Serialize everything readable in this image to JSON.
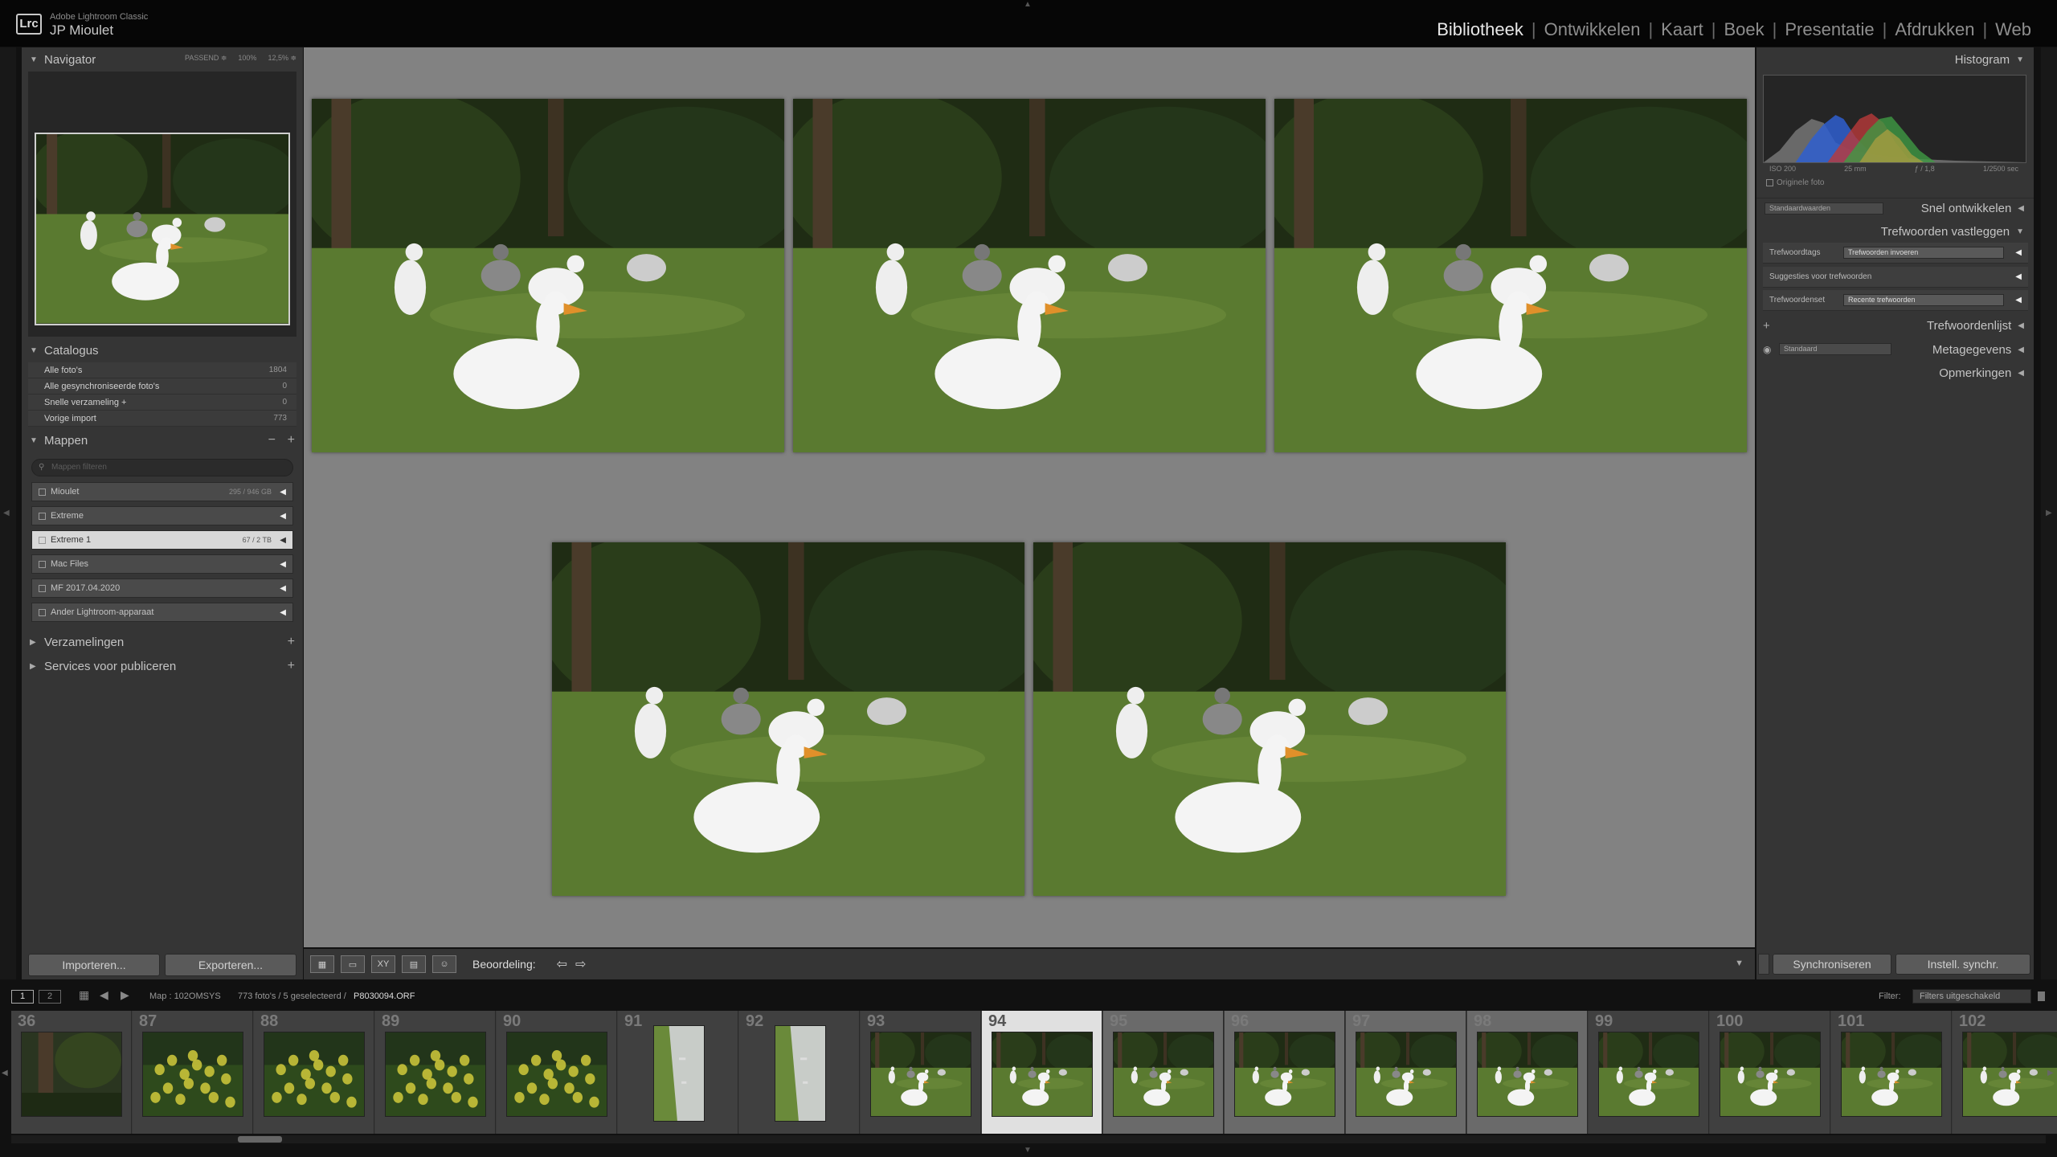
{
  "app": {
    "logo": "Lrc",
    "name": "Adobe Lightroom Classic",
    "user": "JP Mioulet"
  },
  "modules": [
    {
      "label": "Bibliotheek",
      "active": true
    },
    {
      "label": "Ontwikkelen",
      "active": false
    },
    {
      "label": "Kaart",
      "active": false
    },
    {
      "label": "Boek",
      "active": false
    },
    {
      "label": "Presentatie",
      "active": false
    },
    {
      "label": "Afdrukken",
      "active": false
    },
    {
      "label": "Web",
      "active": false
    }
  ],
  "left": {
    "navigator": {
      "title": "Navigator",
      "options": [
        "PASSEND ≑",
        "100%",
        "12,5% ≑"
      ]
    },
    "catalog": {
      "title": "Catalogus",
      "items": [
        {
          "label": "Alle foto's",
          "count": "1804"
        },
        {
          "label": "Alle gesynchroniseerde foto's",
          "count": "0"
        },
        {
          "label": "Snelle verzameling +",
          "count": "0"
        },
        {
          "label": "Vorige import",
          "count": "773"
        }
      ]
    },
    "folders": {
      "title": "Mappen",
      "search_placeholder": "Mappen filteren",
      "items": [
        {
          "label": "Mioulet",
          "size": "295 / 946 GB",
          "selected": false
        },
        {
          "label": "Extreme",
          "size": "",
          "selected": false
        },
        {
          "label": "Extreme 1",
          "size": "67 / 2 TB",
          "selected": true
        },
        {
          "label": "Mac Files",
          "size": "",
          "selected": false
        },
        {
          "label": "MF 2017.04.2020",
          "size": "",
          "selected": false
        },
        {
          "label": "Ander Lightroom-apparaat",
          "size": "",
          "selected": false
        }
      ]
    },
    "collections": {
      "title": "Verzamelingen"
    },
    "publish": {
      "title": "Services voor publiceren"
    },
    "import_label": "Importeren...",
    "export_label": "Exporteren..."
  },
  "toolbar": {
    "rating_label": "Beoordeling:"
  },
  "right": {
    "histogram": {
      "title": "Histogram",
      "iso": "ISO 200",
      "focal": "25 mm",
      "aperture": "ƒ / 1,8",
      "shutter": "1/2500 sec",
      "original_label": "Originele foto"
    },
    "quick_develop": {
      "title": "Snel ontwikkelen",
      "preset": "Standaardwaarden"
    },
    "keywording": {
      "title": "Trefwoorden vastleggen",
      "tags_label": "Trefwoordtags",
      "tags_placeholder": "Trefwoorden invoeren",
      "suggestions_label": "Suggesties voor trefwoorden",
      "set_label": "Trefwoordenset",
      "set_value": "Recente trefwoorden"
    },
    "keyword_list": {
      "title": "Trefwoordenlijst"
    },
    "metadata": {
      "title": "Metagegevens",
      "preset": "Standaard"
    },
    "comments": {
      "title": "Opmerkingen"
    },
    "sync_label": "Synchroniseren",
    "sync_settings_label": "Instell. synchr."
  },
  "filmbar": {
    "screen1": "1",
    "screen2": "2",
    "source": "Map : 102OMSYS",
    "count": "773 foto's / 5 geselecteerd /",
    "filename": "P8030094.ORF",
    "filter_label": "Filter:",
    "filter_value": "Filters uitgeschakeld"
  },
  "filmstrip": [
    {
      "num": "36",
      "kind": "dark",
      "state": "none"
    },
    {
      "num": "87",
      "kind": "yellow",
      "state": "none"
    },
    {
      "num": "88",
      "kind": "yellow",
      "state": "none"
    },
    {
      "num": "89",
      "kind": "yellow",
      "state": "none"
    },
    {
      "num": "90",
      "kind": "yellow",
      "state": "none"
    },
    {
      "num": "91",
      "kind": "water",
      "state": "none"
    },
    {
      "num": "92",
      "kind": "water",
      "state": "none"
    },
    {
      "num": "93",
      "kind": "geese",
      "state": "none"
    },
    {
      "num": "94",
      "kind": "geese",
      "state": "current"
    },
    {
      "num": "95",
      "kind": "geese",
      "state": "selected"
    },
    {
      "num": "96",
      "kind": "geese",
      "state": "selected"
    },
    {
      "num": "97",
      "kind": "geese",
      "state": "selected"
    },
    {
      "num": "98",
      "kind": "geese",
      "state": "selected"
    },
    {
      "num": "99",
      "kind": "geese",
      "state": "none"
    },
    {
      "num": "100",
      "kind": "geese",
      "state": "none"
    },
    {
      "num": "101",
      "kind": "geese",
      "state": "none"
    },
    {
      "num": "102",
      "kind": "geese",
      "state": "none"
    }
  ]
}
